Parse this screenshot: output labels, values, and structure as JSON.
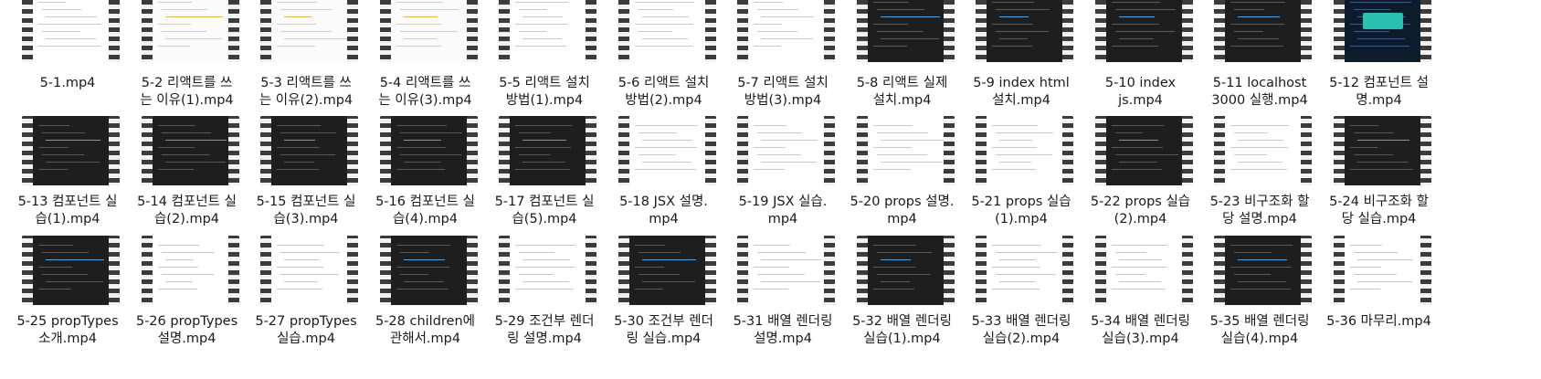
{
  "files": [
    {
      "name": "5-1.mp4",
      "thumb": "light"
    },
    {
      "name": "5-2 리액트를 쓰\n는 이유(1).mp4",
      "thumb": "doc"
    },
    {
      "name": "5-3 리액트를 쓰\n는 이유(2).mp4",
      "thumb": "doc"
    },
    {
      "name": "5-4 리액트를 쓰\n는 이유(3).mp4",
      "thumb": "doc"
    },
    {
      "name": "5-5 리액트 설치\n방법(1).mp4",
      "thumb": "light"
    },
    {
      "name": "5-6 리액트 설치\n방법(2).mp4",
      "thumb": "light"
    },
    {
      "name": "5-7 리액트 설치\n방법(3).mp4",
      "thumb": "light"
    },
    {
      "name": "5-8 리액트 실제\n설치.mp4",
      "thumb": "dark"
    },
    {
      "name": "5-9 index html\n설치.mp4",
      "thumb": "dark"
    },
    {
      "name": "5-10 index\njs.mp4",
      "thumb": "dark"
    },
    {
      "name": "5-11 localhost\n3000 실행.mp4",
      "thumb": "dark"
    },
    {
      "name": "5-12 컴포넌트 설\n명.mp4",
      "thumb": "navy"
    },
    {
      "name": "5-13 컴포넌트 실\n습(1).mp4",
      "thumb": "dark"
    },
    {
      "name": "5-14 컴포넌트 실\n습(2).mp4",
      "thumb": "dark"
    },
    {
      "name": "5-15 컴포넌트 실\n습(3).mp4",
      "thumb": "dark"
    },
    {
      "name": "5-16 컴포넌트 실\n습(4).mp4",
      "thumb": "dark"
    },
    {
      "name": "5-17 컴포넌트 실\n습(5).mp4",
      "thumb": "dark"
    },
    {
      "name": "5-18 JSX 설명.\nmp4",
      "thumb": "light"
    },
    {
      "name": "5-19 JSX 실습.\nmp4",
      "thumb": "light"
    },
    {
      "name": "5-20 props 설명.\nmp4",
      "thumb": "light"
    },
    {
      "name": "5-21 props 실습\n(1).mp4",
      "thumb": "light"
    },
    {
      "name": "5-22 props 실습\n(2).mp4",
      "thumb": "dark"
    },
    {
      "name": "5-23 비구조화 할\n당 설명.mp4",
      "thumb": "light"
    },
    {
      "name": "5-24 비구조화 할\n당 실습.mp4",
      "thumb": "dark"
    },
    {
      "name": "5-25 propTypes\n소개.mp4",
      "thumb": "dark"
    },
    {
      "name": "5-26 propTypes\n설명.mp4",
      "thumb": "light"
    },
    {
      "name": "5-27 propTypes\n실습.mp4",
      "thumb": "light"
    },
    {
      "name": "5-28 children에\n관해서.mp4",
      "thumb": "dark"
    },
    {
      "name": "5-29 조건부 렌더\n링 설명.mp4",
      "thumb": "light"
    },
    {
      "name": "5-30 조건부 렌더\n링 실습.mp4",
      "thumb": "dark"
    },
    {
      "name": "5-31 배열 렌더링\n설명.mp4",
      "thumb": "light"
    },
    {
      "name": "5-32 배열 렌더링\n실습(1).mp4",
      "thumb": "dark"
    },
    {
      "name": "5-33 배열 렌더링\n실습(2).mp4",
      "thumb": "light"
    },
    {
      "name": "5-34 배열 렌더링\n실습(3).mp4",
      "thumb": "light"
    },
    {
      "name": "5-35 배열 렌더링\n실습(4).mp4",
      "thumb": "dark"
    },
    {
      "name": "5-36 마무리.mp4",
      "thumb": "light"
    }
  ],
  "icon": "video-file-icon"
}
